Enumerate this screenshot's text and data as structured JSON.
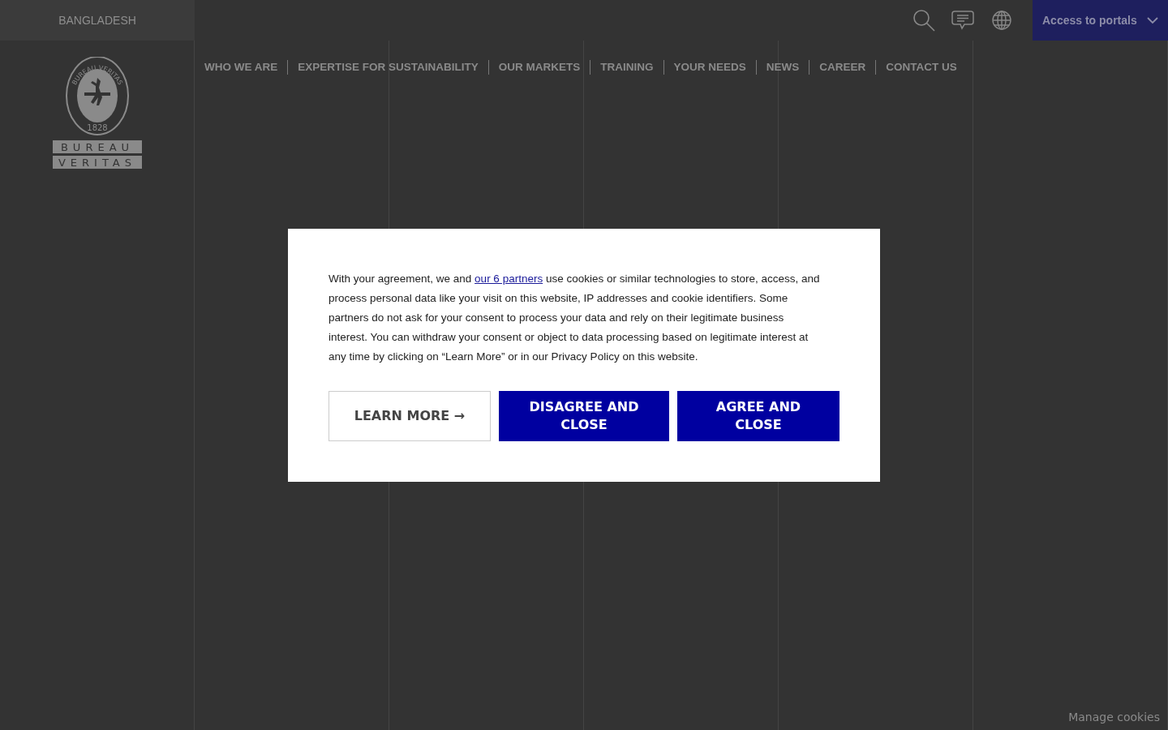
{
  "top_bar": {
    "country": "BANGLADESH",
    "portals_button": "Access to portals"
  },
  "logo": {
    "ring_text": "BUREAU VERITAS",
    "year": "1828",
    "words": [
      "BUREAU",
      "VERITAS"
    ]
  },
  "nav": [
    "WHO WE ARE",
    "EXPERTISE FOR SUSTAINABILITY",
    "OUR MARKETS",
    "TRAINING",
    "YOUR NEEDS",
    "NEWS",
    "CAREER",
    "CONTACT US"
  ],
  "cookie_dialog": {
    "text_before": "With your agreement, we and",
    "link": "our 6 partners",
    "text_after": "use cookies or similar technologies to store, access, and process personal data like your visit on this website, IP addresses and cookie identifiers. Some partners do not ask for your consent to process your data and rely on their legitimate business interest. You can withdraw your consent or object to data processing based on legitimate interest at any time by clicking on “Learn More” or in our Privacy Policy on this website.",
    "buttons": [
      {
        "label": "LEARN MORE →",
        "kind": "outline"
      },
      {
        "label": "DISAGREE AND CLOSE",
        "kind": "filled"
      },
      {
        "label": "AGREE AND CLOSE",
        "kind": "filled"
      }
    ]
  },
  "manage_cookies": "Manage cookies"
}
